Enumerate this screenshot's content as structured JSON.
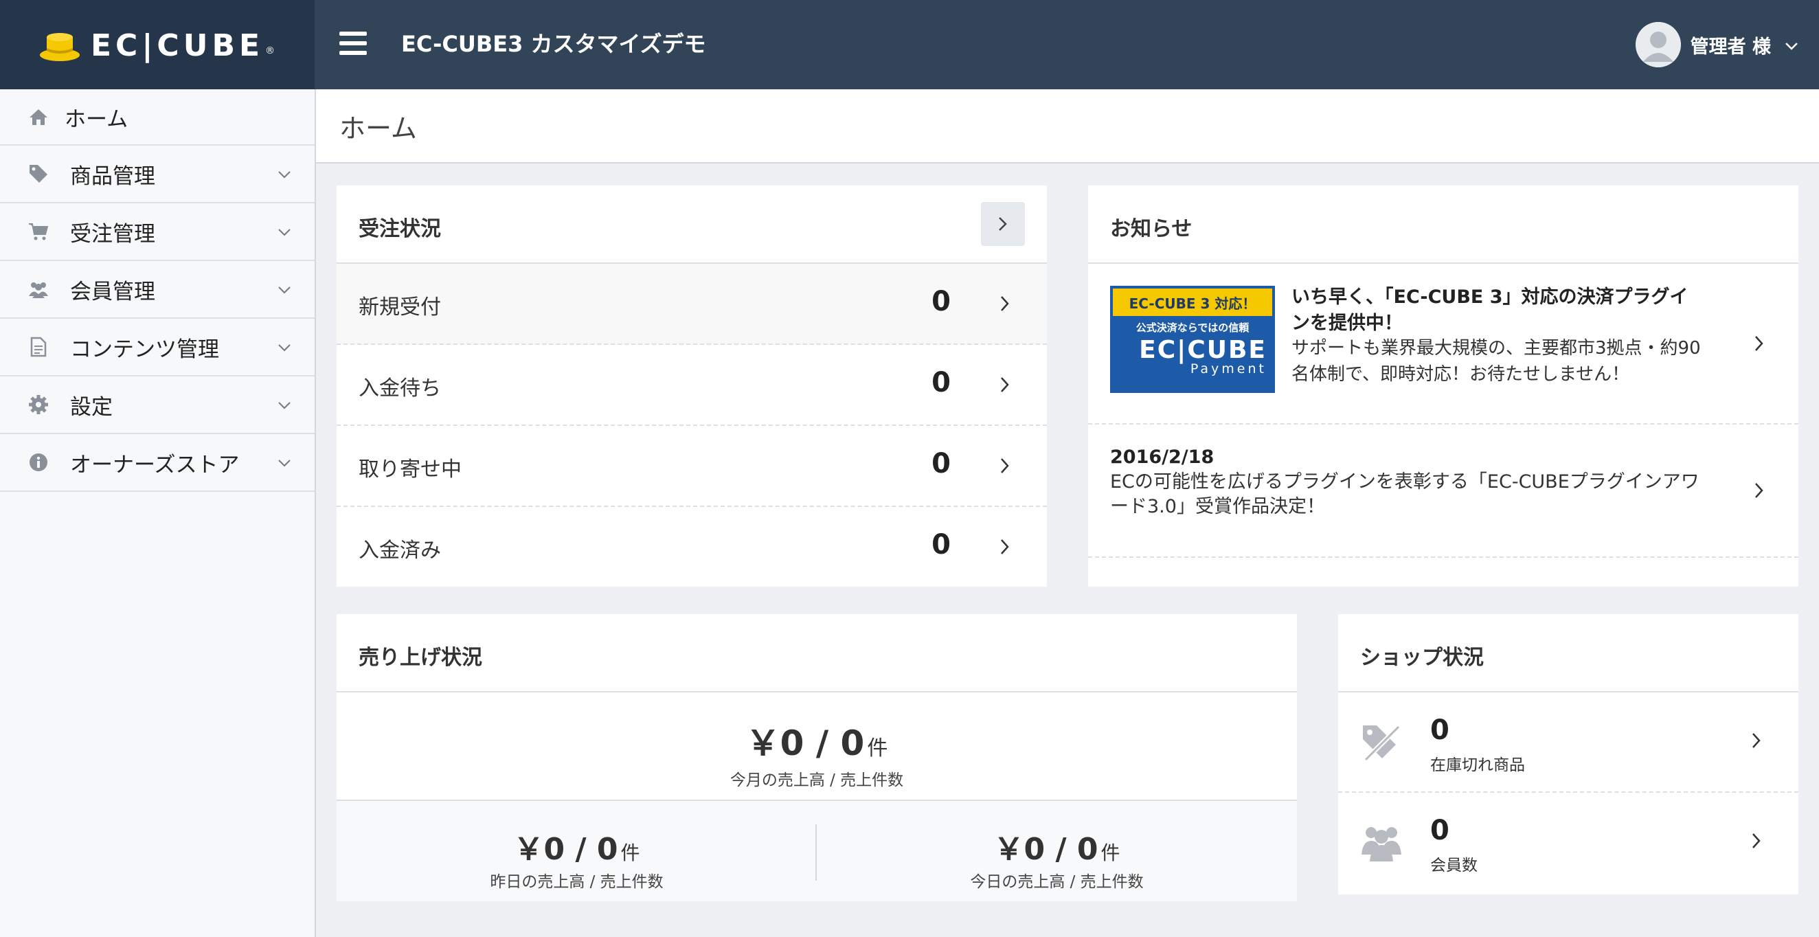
{
  "header": {
    "logo_text": "EC|CUBE",
    "site_title": "EC-CUBE3 カスタマイズデモ",
    "user_name": "管理者 様"
  },
  "sidebar": {
    "items": [
      {
        "label": "ホーム",
        "icon": "home-icon"
      },
      {
        "label": "商品管理",
        "icon": "tag-icon"
      },
      {
        "label": "受注管理",
        "icon": "cart-icon"
      },
      {
        "label": "会員管理",
        "icon": "users-icon"
      },
      {
        "label": "コンテンツ管理",
        "icon": "document-icon"
      },
      {
        "label": "設定",
        "icon": "gear-icon"
      },
      {
        "label": "オーナーズストア",
        "icon": "info-icon"
      }
    ]
  },
  "page": {
    "title": "ホーム"
  },
  "orders": {
    "title": "受注状況",
    "rows": [
      {
        "label": "新規受付",
        "count": "0"
      },
      {
        "label": "入金待ち",
        "count": "0"
      },
      {
        "label": "取り寄せ中",
        "count": "0"
      },
      {
        "label": "入金済み",
        "count": "0"
      }
    ]
  },
  "news": {
    "title": "お知らせ",
    "banner": {
      "top": "EC-CUBE 3 対応！",
      "mid": "公式決済ならではの信頼",
      "logo": "EC|CUBE",
      "sub": "Payment"
    },
    "featured": {
      "title": "いち早く、「EC-CUBE 3」対応の決済プラグインを提供中！",
      "body": "サポートも業界最大規模の、主要都市3拠点・約90名体制で、即時対応！お待たせしません！"
    },
    "items": [
      {
        "date": "2016/2/18",
        "text": "ECの可能性を広げるプラグインを表彰する「EC-CUBEプラグインアワード3.0」受賞作品決定！"
      }
    ]
  },
  "sales": {
    "title": "売り上げ状況",
    "month": {
      "amount": "￥0 / 0",
      "unit": "件",
      "caption": "今月の売上高 / 売上件数"
    },
    "yesterday": {
      "amount": "￥0 / 0",
      "unit": "件",
      "caption": "昨日の売上高 / 売上件数"
    },
    "today": {
      "amount": "￥0 / 0",
      "unit": "件",
      "caption": "今日の売上高 / 売上件数"
    }
  },
  "shop": {
    "title": "ショップ状況",
    "rows": [
      {
        "count": "0",
        "label": "在庫切れ商品",
        "icon": "tag-off-icon"
      },
      {
        "count": "0",
        "label": "会員数",
        "icon": "users-icon"
      }
    ]
  },
  "colors": {
    "header_bg": "#324457",
    "logo_bg": "#25364a",
    "accent_yellow": "#f5c800",
    "page_bg": "#eff0f4"
  }
}
